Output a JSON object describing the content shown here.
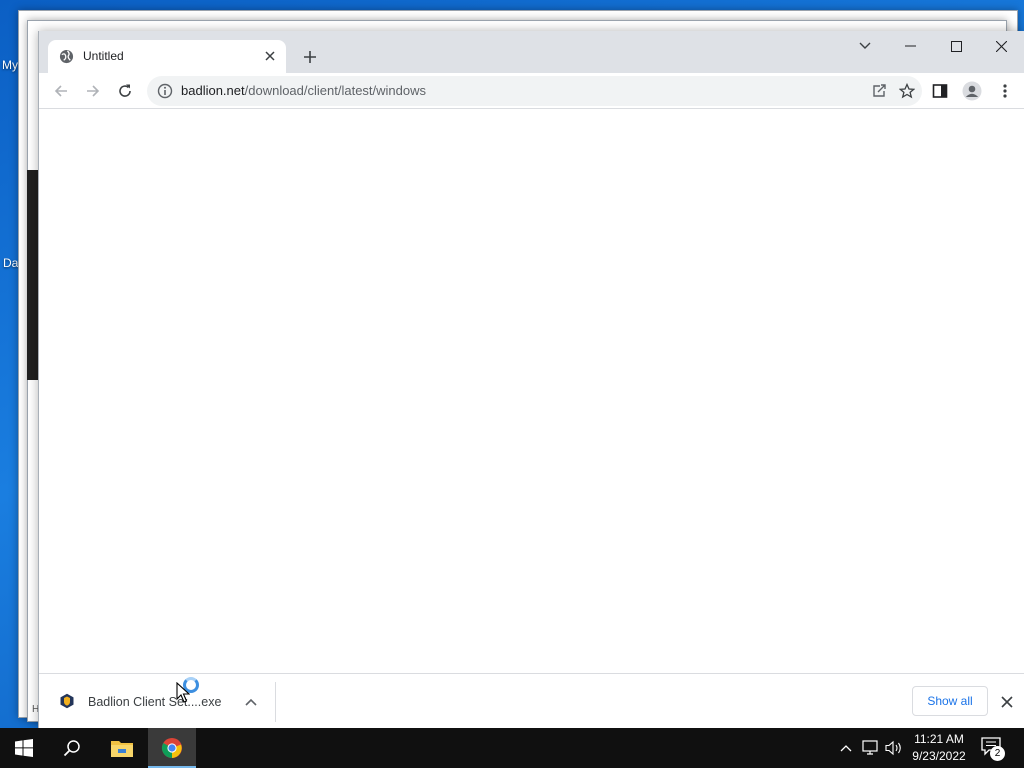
{
  "desktop": {
    "labels": [
      "My",
      "Da",
      "H"
    ]
  },
  "browser": {
    "tab": {
      "title": "Untitled"
    },
    "url": {
      "host": "badlion.net",
      "path": "/download/client/latest/windows"
    }
  },
  "downloads": {
    "item_name": "Badlion Client Set....exe",
    "show_all_label": "Show all"
  },
  "taskbar": {
    "time": "11:21 AM",
    "date": "9/23/2022",
    "notification_count": "2"
  },
  "colors": {
    "accent": "#1a73e8",
    "desktop": "#0b5fc4",
    "taskbar": "#101010"
  }
}
